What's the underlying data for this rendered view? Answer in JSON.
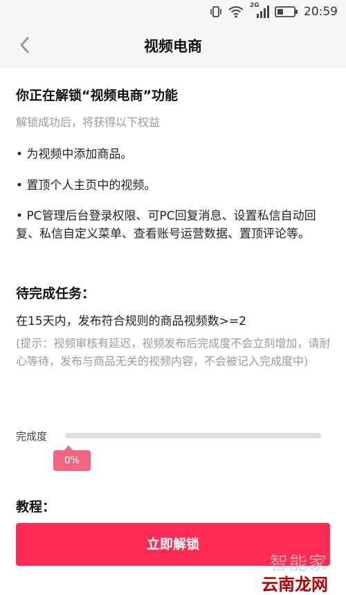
{
  "status_bar": {
    "network": "2G",
    "time": "20:59",
    "icons": [
      "vibrate-icon",
      "wifi-icon",
      "signal-icon",
      "battery-icon"
    ]
  },
  "nav": {
    "back_icon": "chevron-left-icon",
    "title": "视频电商"
  },
  "unlock": {
    "title": "你正在解锁“视频电商”功能",
    "subtitle": "解锁成功后，将获得以下权益",
    "benefits": [
      "• 为视频中添加商品。",
      "• 置顶个人主页中的视频。",
      "• PC管理后台登录权限、可PC回复消息、设置私信自动回复、私信自定义菜单、查看账号运营数据、置顶评论等。"
    ]
  },
  "task": {
    "title": "待完成任务：",
    "description": "在15天内，发布符合规则的商品视频数>=2",
    "tip": "(提示：视频审核有延迟，视频发布后完成度不会立刻增加，请耐心等待，发布与商品无关的视频内容，不会被记入完成度中)"
  },
  "progress": {
    "label": "完成度",
    "value_text": "0%",
    "fraction": 0
  },
  "tutorial": {
    "title": "教程："
  },
  "bottom": {
    "button_label": "立即解锁",
    "watermark_top": "智能家",
    "watermark_bottom": "云南龙网"
  },
  "colors": {
    "accent": "#fe2c55",
    "tip_badge": "#f0657f",
    "muted_text": "#9a9a9a"
  }
}
